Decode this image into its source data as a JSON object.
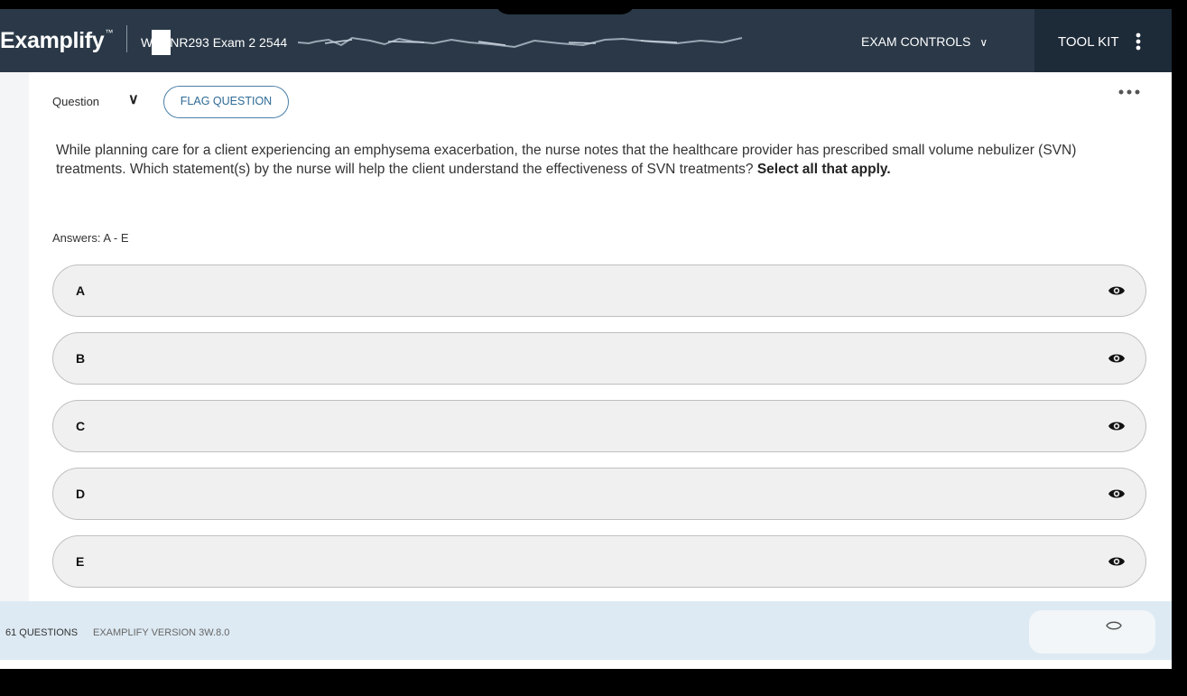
{
  "header": {
    "brand": "Examplify",
    "brand_mark": "™",
    "exam_title": "W",
    "exam_title_rest": "NR293 Exam 2 2544",
    "exam_controls_label": "EXAM CONTROLS",
    "toolkit_label": "TOOL KIT"
  },
  "question": {
    "label": "Question",
    "flag_label": "FLAG QUESTION",
    "text": "While planning care for a client experiencing an emphysema exacerbation, the nurse notes that the healthcare provider has prescribed small volume nebulizer (SVN) treatments. Which statement(s) by the nurse will help the client understand the effectiveness of SVN treatments? ",
    "text_emphasis": "Select all that apply.",
    "answers_label": "Answers: A - E"
  },
  "options": [
    {
      "letter": "A"
    },
    {
      "letter": "B"
    },
    {
      "letter": "C"
    },
    {
      "letter": "D"
    },
    {
      "letter": "E"
    }
  ],
  "footer": {
    "questions_count": "61 QUESTIONS",
    "version": "EXAMPLIFY VERSION 3W.8.0"
  },
  "icons": {
    "exam_controls": "chevron-down-icon",
    "toolkit": "kebab-icon",
    "more": "more-horizontal-icon",
    "option_action": "eye-icon"
  },
  "colors": {
    "topbar": "#2a3847",
    "toolkit_bg": "#1d2a38",
    "flag_border": "#4a7fa8",
    "footer_bg": "#ddeaf3"
  }
}
